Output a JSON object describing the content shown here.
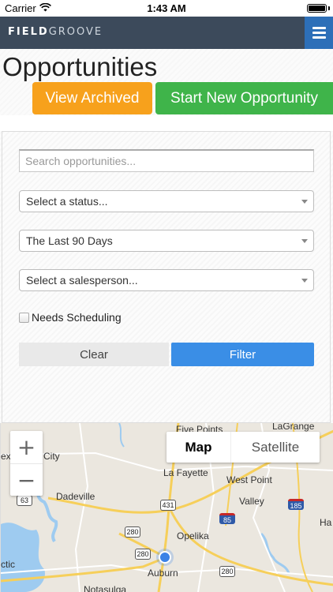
{
  "status_bar": {
    "carrier": "Carrier",
    "time": "1:43 AM"
  },
  "header": {
    "logo_bold": "FIELD",
    "logo_light": "GROOVE"
  },
  "page": {
    "title": "Opportunities",
    "view_archived_label": "View Archived",
    "new_opportunity_label": "Start New Opportunity"
  },
  "filters": {
    "search_placeholder": "Search opportunities...",
    "status_select": "Select a status...",
    "date_select": "The Last 90 Days",
    "salesperson_select": "Select a salesperson...",
    "needs_scheduling_label": "Needs Scheduling",
    "needs_scheduling_checked": false,
    "clear_label": "Clear",
    "filter_label": "Filter"
  },
  "map": {
    "zoom_in": "+",
    "zoom_out": "−",
    "type_map": "Map",
    "type_satellite": "Satellite",
    "places": [
      "Five Points",
      "LaGrange",
      "La Fayette",
      "West Point",
      "Dadeville",
      "Valley",
      "Opelika",
      "Auburn",
      "Notasulga",
      "City",
      "ex",
      "ctic",
      "Ha"
    ],
    "routes": [
      "63",
      "431",
      "85",
      "185",
      "280",
      "280",
      "280"
    ],
    "colors": {
      "land": "#ebe7df",
      "water": "#9ecbf0",
      "highway": "#f6cf5a",
      "road": "#ffffff",
      "location": "#3b82e6"
    }
  }
}
